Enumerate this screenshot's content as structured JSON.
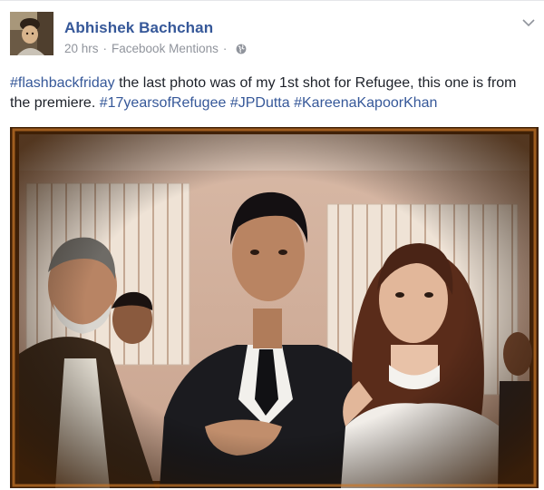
{
  "post": {
    "author": "Abhishek Bachchan",
    "time": "20 hrs",
    "app": "Facebook Mentions",
    "separator": "·",
    "text": {
      "tag1": "#flashbackfriday",
      "body": " the last photo was of my 1st shot for Refugee, this one is from the premiere. ",
      "tag2": "#17yearsofRefugee",
      "tag3": "#JPDutta",
      "tag4": "#KareenaKapoorKhan"
    }
  },
  "icons": {
    "privacy": "globe-icon",
    "menu": "chevron-down-icon"
  },
  "colors": {
    "link": "#365899",
    "meta": "#90949c",
    "text": "#1d2129"
  }
}
